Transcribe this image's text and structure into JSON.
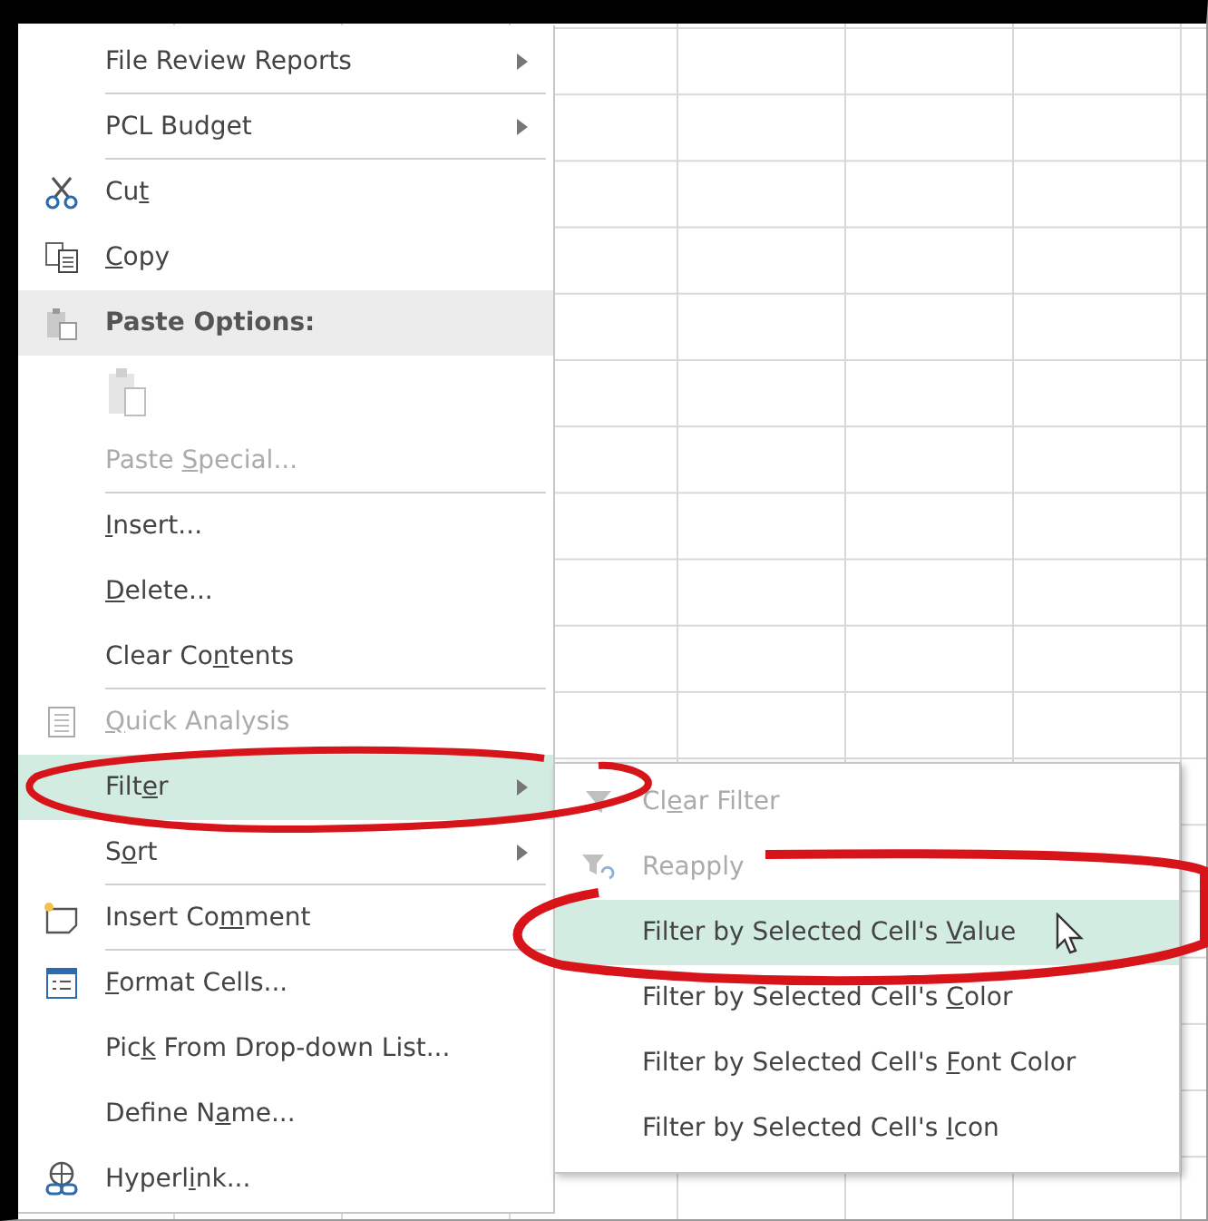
{
  "context_menu": {
    "items": [
      {
        "kind": "submenu",
        "before": "File Review Reports",
        "disabled": false,
        "highlighted": false,
        "separator_after": true
      },
      {
        "kind": "submenu",
        "before": "PCL Budget",
        "disabled": false,
        "highlighted": false,
        "separator_after": true
      },
      {
        "kind": "item",
        "before": "Cu",
        "key": "t",
        "disabled": false,
        "highlighted": false,
        "separator_after": false
      },
      {
        "kind": "item",
        "key": "C",
        "after": "opy",
        "disabled": false,
        "highlighted": false,
        "separator_after": false
      },
      {
        "kind": "header",
        "before": "Paste Options:",
        "disabled": false,
        "highlighted": false,
        "separator_after": false
      },
      {
        "kind": "paste-icons",
        "disabled": true,
        "highlighted": false,
        "separator_after": false
      },
      {
        "kind": "item",
        "before": "Paste ",
        "key": "S",
        "after": "pecial...",
        "disabled": true,
        "highlighted": false,
        "separator_after": true
      },
      {
        "kind": "item",
        "key": "I",
        "after": "nsert...",
        "disabled": false,
        "highlighted": false,
        "separator_after": false
      },
      {
        "kind": "item",
        "key": "D",
        "after": "elete...",
        "disabled": false,
        "highlighted": false,
        "separator_after": false
      },
      {
        "kind": "item",
        "before": "Clear Co",
        "key": "n",
        "after": "tents",
        "disabled": false,
        "highlighted": false,
        "separator_after": true
      },
      {
        "kind": "item",
        "key": "Q",
        "after": "uick Analysis",
        "disabled": true,
        "highlighted": false,
        "separator_after": false
      },
      {
        "kind": "submenu",
        "before": "Filt",
        "key": "e",
        "after": "r",
        "disabled": false,
        "highlighted": true,
        "separator_after": false
      },
      {
        "kind": "submenu",
        "before": "S",
        "key": "o",
        "after": "rt",
        "disabled": false,
        "highlighted": false,
        "separator_after": true
      },
      {
        "kind": "item",
        "before": "Insert Co",
        "key": "m",
        "after": "ment",
        "disabled": false,
        "highlighted": false,
        "separator_after": true
      },
      {
        "kind": "item",
        "key": "F",
        "after": "ormat Cells...",
        "disabled": false,
        "highlighted": false,
        "separator_after": false
      },
      {
        "kind": "item",
        "before": "Pic",
        "key": "k",
        "after": " From Drop-down List...",
        "disabled": false,
        "highlighted": false,
        "separator_after": false
      },
      {
        "kind": "item",
        "before": "Define N",
        "key": "a",
        "after": "me...",
        "disabled": false,
        "highlighted": false,
        "separator_after": false
      },
      {
        "kind": "item",
        "before": "Hyperl",
        "key": "i",
        "after": "nk...",
        "disabled": false,
        "highlighted": false,
        "separator_after": false
      }
    ]
  },
  "filter_submenu": {
    "items": [
      {
        "before": "Cl",
        "key": "e",
        "after": "ar Filter",
        "disabled": true,
        "highlighted": false
      },
      {
        "before": "Reapply",
        "disabled": true,
        "highlighted": false
      },
      {
        "before": "Filter by Selected Cell's ",
        "key": "V",
        "after": "alue",
        "disabled": false,
        "highlighted": true
      },
      {
        "before": "Filter by Selected Cell's ",
        "key": "C",
        "after": "olor",
        "disabled": false,
        "highlighted": false
      },
      {
        "before": "Filter by Selected Cell's ",
        "key": "F",
        "after": "ont Color",
        "disabled": false,
        "highlighted": false
      },
      {
        "before": "Filter by Selected Cell's ",
        "key": "I",
        "after": "con",
        "disabled": false,
        "highlighted": false
      }
    ]
  }
}
